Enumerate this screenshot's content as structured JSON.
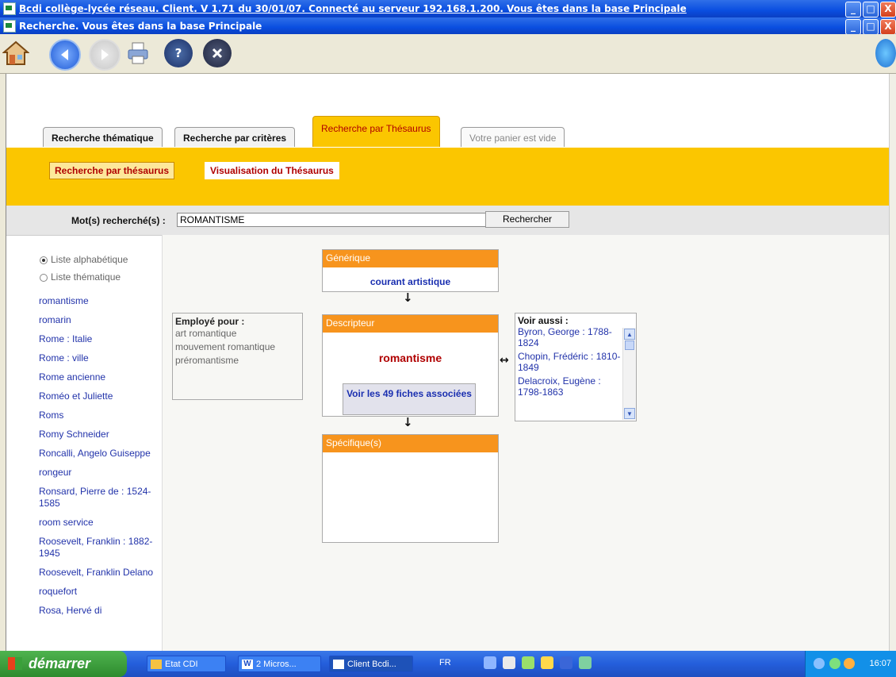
{
  "window1": {
    "title": "Bcdi collège-lycée réseau. Client. V 1.71 du 30/01/07. Connecté au serveur 192.168.1.200.  Vous êtes dans la base Principale"
  },
  "window2": {
    "title": "Recherche. Vous êtes dans la base Principale"
  },
  "toolbar": {
    "icons": [
      "home-icon",
      "back-icon",
      "forward-icon",
      "print-icon",
      "help-icon",
      "close-icon",
      "globe-icon"
    ]
  },
  "tabs": [
    {
      "label": "Recherche thématique"
    },
    {
      "label": "Recherche par critères"
    },
    {
      "label": "Recherche par Thésaurus"
    },
    {
      "label": "Votre panier est vide"
    }
  ],
  "subtabs": [
    {
      "label": "Recherche par thésaurus"
    },
    {
      "label": "Visualisation du Thésaurus"
    }
  ],
  "search": {
    "label": "Mot(s) recherché(s) :",
    "value": "ROMANTISME",
    "button": "Rechercher"
  },
  "list_options": [
    {
      "label": "Liste alphabétique",
      "checked": true
    },
    {
      "label": "Liste thématique",
      "checked": false
    }
  ],
  "word_list": [
    "romantisme",
    "romarin",
    "Rome : Italie",
    "Rome : ville",
    "Rome ancienne",
    "Roméo et Juliette",
    "Roms",
    "Romy Schneider",
    "Roncalli, Angelo Guiseppe",
    "rongeur",
    "Ronsard, Pierre de : 1524-1585",
    "room service",
    "Roosevelt, Franklin : 1882-1945",
    "Roosevelt, Franklin Delano",
    "roquefort",
    "Rosa, Hervé di"
  ],
  "employe_pour": {
    "heading": "Employé pour :",
    "items": [
      "art romantique",
      "mouvement romantique",
      "préromantisme"
    ]
  },
  "generique": {
    "heading": "Générique",
    "value": "courant artistique"
  },
  "descripteur": {
    "heading": "Descripteur",
    "value": "romantisme",
    "button": "Voir les 49 fiches associées"
  },
  "specifique": {
    "heading": "Spécifique(s)"
  },
  "voir_aussi": {
    "heading": "Voir aussi :",
    "items": [
      "Byron, George : 1788-1824",
      "Chopin, Frédéric : 1810-1849",
      "Delacroix, Eugène : 1798-1863"
    ]
  },
  "taskbar": {
    "start": "démarrer",
    "items": [
      "Etat CDI",
      "2 Micros...",
      "Client Bcdi..."
    ],
    "lang": "FR",
    "clock": "16:07"
  },
  "colors": {
    "accent": "#fbc600",
    "header_orange": "#f7941d",
    "link_blue": "#2233aa",
    "title_red": "#b00000"
  }
}
